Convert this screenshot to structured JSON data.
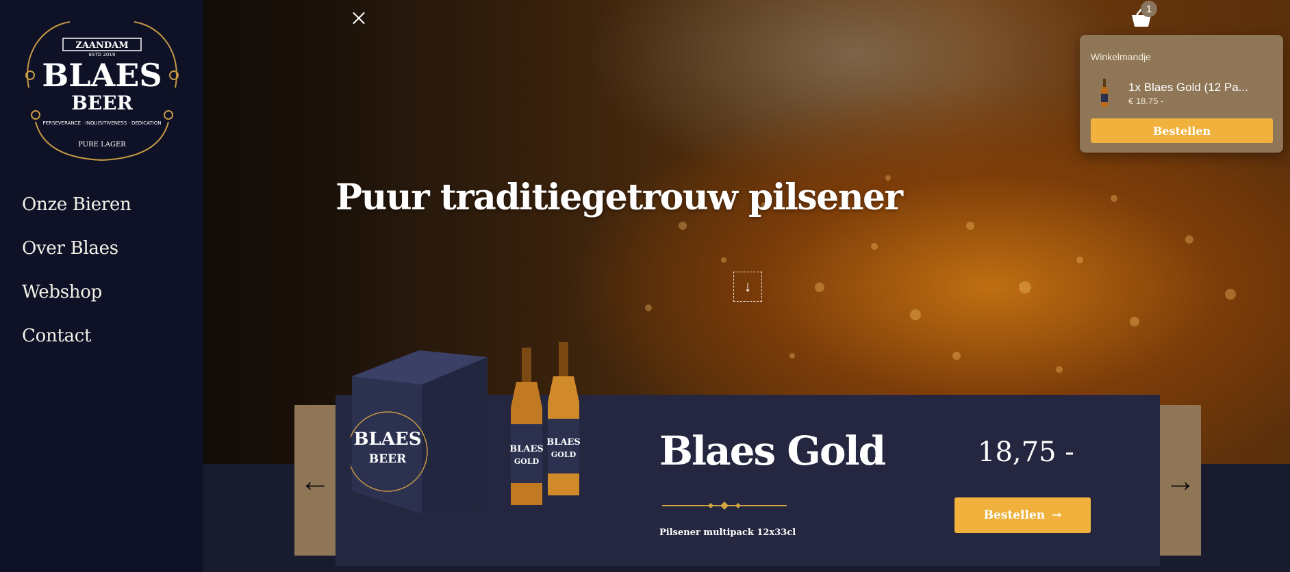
{
  "brand": {
    "logo_text": "BLAES BEER",
    "logo_city": "ZAANDAM",
    "logo_est": "ESTD 2019",
    "logo_values": "PERSEVERANCE · INQUISITIVENESS · DEDICATION",
    "logo_tagline": "PURE LAGER"
  },
  "nav": {
    "items": [
      {
        "label": "Onze Bieren"
      },
      {
        "label": "Over Blaes"
      },
      {
        "label": "Webshop"
      },
      {
        "label": "Contact"
      }
    ]
  },
  "hero": {
    "headline": "Puur traditiegetrouw pilsener",
    "scroll_icon": "arrow-down-icon",
    "close_icon": "close-icon"
  },
  "cart": {
    "icon": "basket-icon",
    "count": "1",
    "dropdown_title": "Winkelmandje",
    "item_name": "1x Blaes Gold (12 Pa...",
    "item_price": "€ 18.75 -",
    "order_label": "Bestellen"
  },
  "product": {
    "name": "Blaes Gold",
    "subtitle": "Pilsener multipack 12x33cl",
    "price": "18,75 -",
    "order_label": "Bestellen",
    "order_icon": "arrow-right-icon",
    "prev_icon": "arrow-left-icon",
    "next_icon": "arrow-right-icon",
    "box_text": "BLAES BEER",
    "bottle_label": "BLAES GOLD"
  },
  "colors": {
    "sidebar": "#0f1226",
    "accent": "#f0b23c",
    "tan": "#8e7657",
    "card": "#24273f"
  }
}
